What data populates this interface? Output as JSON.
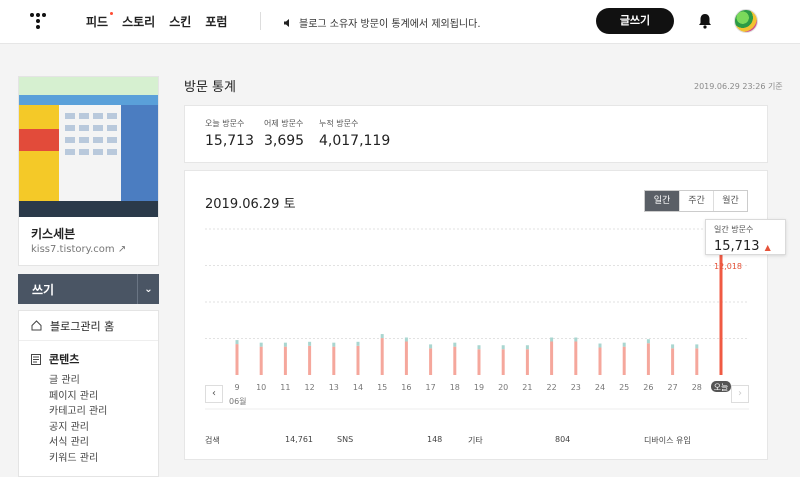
{
  "header": {
    "nav": [
      "피드",
      "스토리",
      "스킨",
      "포럼"
    ],
    "notice": "블로그 소유자 방문이 통계에서 제외됩니다.",
    "write_label": "글쓰기"
  },
  "sidebar": {
    "blog_name": "키스세븐",
    "blog_url": "kiss7.tistory.com",
    "write_bar": "쓰기",
    "home": "블로그관리 홈",
    "section": "콘텐츠",
    "items": [
      "글 관리",
      "페이지 관리",
      "카테고리 관리",
      "공지 관리",
      "서식 관리",
      "키워드 관리"
    ]
  },
  "main": {
    "title": "방문 통계",
    "timestamp": "2019.06.29 23:26 기준",
    "stats": [
      {
        "label": "오늘 방문수",
        "value": "15,713"
      },
      {
        "label": "어제 방문수",
        "value": "3,695"
      },
      {
        "label": "누적 방문수",
        "value": "4,017,119"
      }
    ],
    "chart_date": "2019.06.29 토",
    "tabs": [
      "일간",
      "주간",
      "월간"
    ],
    "tooltip": {
      "label": "일간 방문수",
      "value": "15,713",
      "increase": "12,018"
    },
    "month_label": "06월",
    "bottom": [
      {
        "label": "검색",
        "value": "14,761"
      },
      {
        "label": "SNS",
        "value": "148"
      },
      {
        "label": "기타",
        "value": "804"
      },
      {
        "label": "디바이스 유입",
        "value": ""
      }
    ]
  },
  "chart_data": {
    "type": "bar",
    "categories": [
      "9",
      "10",
      "11",
      "12",
      "13",
      "14",
      "15",
      "16",
      "17",
      "18",
      "19",
      "20",
      "21",
      "22",
      "23",
      "24",
      "25",
      "26",
      "27",
      "28",
      "오늘"
    ],
    "values": [
      3600,
      3300,
      3300,
      3400,
      3300,
      3400,
      4300,
      3900,
      3100,
      3300,
      3000,
      3000,
      3000,
      3900,
      3900,
      3200,
      3300,
      3700,
      3100,
      3100,
      15713
    ],
    "ylim": [
      0,
      17000
    ],
    "highlight_index": 20,
    "colors": {
      "bar": "#f5a79c",
      "highlight": "#f05a43",
      "cap": "#a9d6d0"
    }
  }
}
